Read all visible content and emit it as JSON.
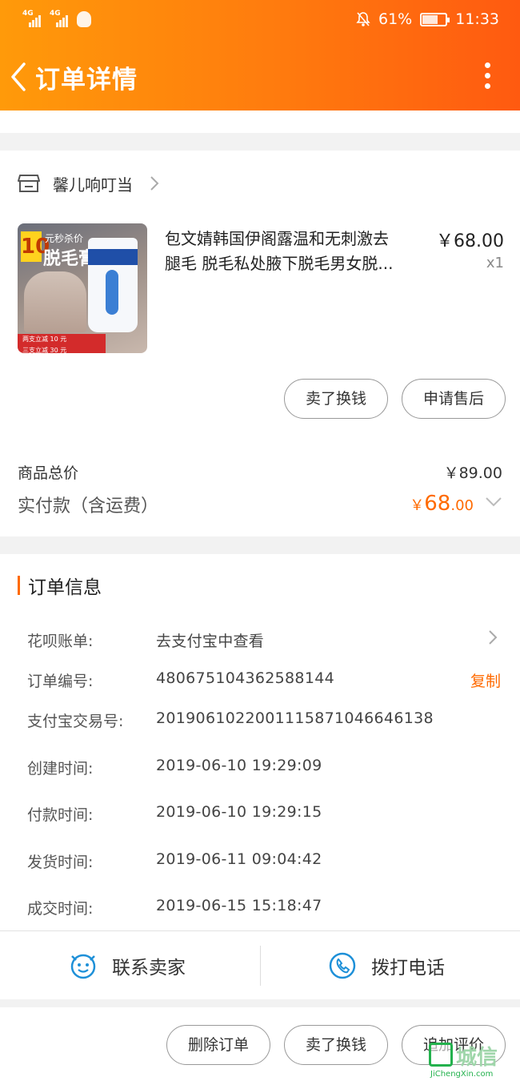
{
  "status_bar": {
    "network_1": "4G",
    "network_2": "4G",
    "battery": "61%",
    "time": "11:33"
  },
  "nav": {
    "title": "订单详情"
  },
  "shop": {
    "name": "馨儿响叮当"
  },
  "product": {
    "title_line1": "包文婧韩国伊阁露温和无刺激去",
    "title_line2": "腿毛 脱毛私处腋下脱毛男女脱...",
    "price": "￥68.00",
    "quantity": "x1",
    "image_text": {
      "number": "10",
      "line1": "元秒杀价",
      "line2": "脱毛膏",
      "promo1": "两支立减 10 元",
      "promo2": "三支立减 30 元"
    }
  },
  "item_actions": {
    "sell_label": "卖了换钱",
    "after_sale_label": "申请售后"
  },
  "summary": {
    "goods_total_label": "商品总价",
    "goods_total_value": "￥89.00",
    "paid_label": "实付款（含运费）",
    "paid_currency": "￥",
    "paid_integer": "68",
    "paid_decimal": ".00"
  },
  "order_info": {
    "section_title": "订单信息",
    "rows": [
      {
        "label": "花呗账单:",
        "value": "去支付宝中查看"
      },
      {
        "label": "订单编号:",
        "value": "480675104362588144"
      },
      {
        "label": "支付宝交易号:",
        "value": "2019061022001115871046646138"
      },
      {
        "label": "创建时间:",
        "value": "2019-06-10 19:29:09"
      },
      {
        "label": "付款时间:",
        "value": "2019-06-10 19:29:15"
      },
      {
        "label": "发货时间:",
        "value": "2019-06-11 09:04:42"
      },
      {
        "label": "成交时间:",
        "value": "2019-06-15 15:18:47"
      }
    ],
    "copy_label": "复制"
  },
  "contact": {
    "seller_label": "联系卖家",
    "call_label": "拨打电话"
  },
  "bottom_actions": {
    "delete_label": "删除订单",
    "sell_label": "卖了换钱",
    "review_label": "追加评价"
  },
  "watermark": {
    "text": "城信",
    "sub": "JiChengXin.com"
  },
  "colors": {
    "accent": "#ff6a00",
    "header_start": "#ff9a0a",
    "header_end": "#ff5a10"
  }
}
